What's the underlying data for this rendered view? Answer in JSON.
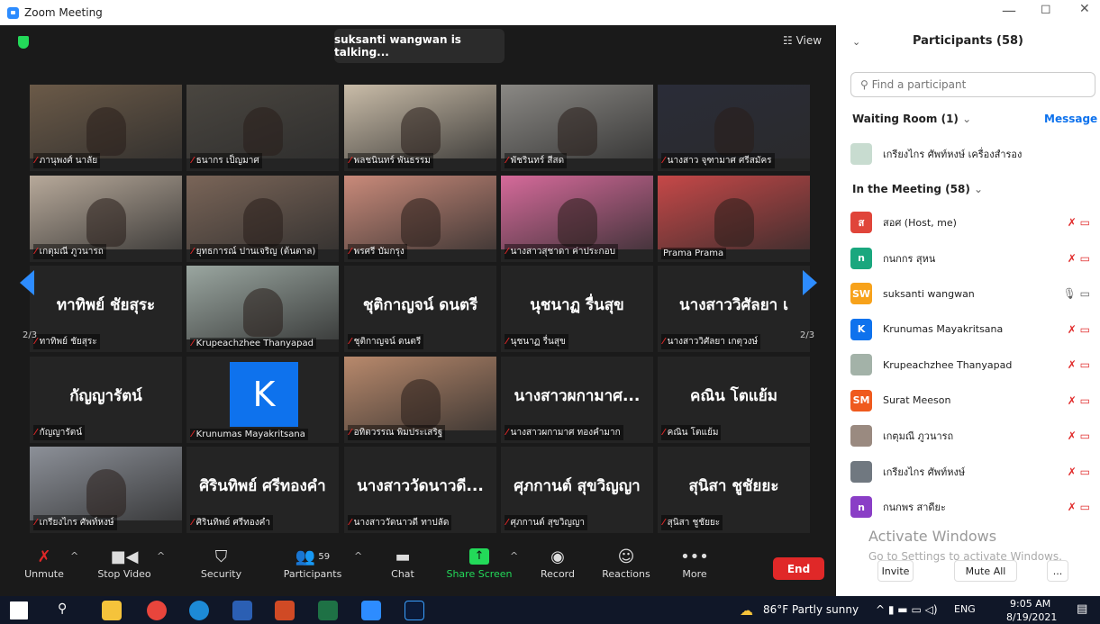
{
  "window": {
    "title": "Zoom Meeting",
    "min": "—",
    "max": "◻",
    "close": "✕"
  },
  "video": {
    "talking": "suksanti wangwan is talking...",
    "view": "☷ View",
    "page_left": "2/3",
    "page_right": "2/3"
  },
  "tiles": [
    {
      "label": "ภานุพงศ์ นาลัย",
      "kind": "photo",
      "color": "#6b5a48"
    },
    {
      "label": "ธนากร เป็ญมาศ",
      "kind": "photo",
      "color": "#4a4640"
    },
    {
      "label": "พลชนินทร์ พันธรรม",
      "kind": "photo",
      "color": "#c9bca8"
    },
    {
      "label": "พัชรินทร์ สีสด",
      "kind": "photo",
      "color": "#8a8884"
    },
    {
      "label": "นางสาว จุฑามาศ ศรีสมัคร",
      "kind": "photo",
      "color": "#2a2c38"
    },
    {
      "label": "เกตุมณี ภูวนารถ",
      "kind": "photo",
      "color": "#b7a99a"
    },
    {
      "label": "ยุทธการณ์ ปานเจริญ (ต้นตาล)",
      "kind": "photo",
      "color": "#7a6558"
    },
    {
      "label": "พรศรี บัมกรุง",
      "kind": "photo",
      "color": "#c98a7a"
    },
    {
      "label": "นางสาวสุชาดา ค่าประกอบ",
      "kind": "photo",
      "color": "#d56a9a"
    },
    {
      "label": "Prama Prama",
      "kind": "photo",
      "color": "#c64848"
    },
    {
      "label": "ทาทิพย์ ชัยสุระ",
      "kind": "text",
      "name": "ทาทิพย์ ชัยสุระ"
    },
    {
      "label": "Krupeachzhee Thanyapad",
      "kind": "photo",
      "color": "#9aa6a0"
    },
    {
      "label": "ชุติกาญจน์ ดนตรี",
      "kind": "text",
      "name": "ชุติกาญจน์ ดนตรี"
    },
    {
      "label": "นุชนาฏ รื่นสุข",
      "kind": "text",
      "name": "นุชนาฏ รื่นสุข"
    },
    {
      "label": "นางสาววิศัลยา เกตุวงษ์",
      "kind": "text",
      "name": "นางสาววิศัลยา เ"
    },
    {
      "label": "กัญญารัตน์",
      "kind": "text",
      "name": "กัญญารัตน์"
    },
    {
      "label": "Krunumas Mayakritsana",
      "kind": "avatar",
      "letter": "K"
    },
    {
      "label": "อทิตวรรณ พิมประเสริฐ",
      "kind": "photo",
      "color": "#b8896c"
    },
    {
      "label": "นางสาวผกามาศ ทองคำมาก",
      "kind": "text",
      "name": "นางสาวผกามาศ..."
    },
    {
      "label": "คณิน โตแย้ม",
      "kind": "text",
      "name": "คณิน โตแย้ม"
    },
    {
      "label": "เกรียงไกร ศัพท์หงษ์",
      "kind": "photo",
      "color": "#8c9098"
    },
    {
      "label": "ศิรินทิพย์ ศรีทองคำ",
      "kind": "text",
      "name": "ศิรินทิพย์ ศรีทองคำ"
    },
    {
      "label": "นางสาววัดนาวดี ทาปลัด",
      "kind": "text",
      "name": "นางสาววัดนาวดี..."
    },
    {
      "label": "ศุภกานต์ สุขวิญญา",
      "kind": "text",
      "name": "ศุภกานต์ สุขวิญญา"
    },
    {
      "label": "สุนิสา ชูชัยยะ",
      "kind": "text",
      "name": "สุนิสา ชูชัยยะ"
    }
  ],
  "toolbar": {
    "unmute": "Unmute",
    "stop_video": "Stop Video",
    "security": "Security",
    "participants": "Participants",
    "participants_count": "59",
    "chat": "Chat",
    "share": "Share Screen",
    "record": "Record",
    "reactions": "Reactions",
    "more": "More",
    "end": "End"
  },
  "panel": {
    "title": "Participants (58)",
    "search_placeholder": "Find a participant",
    "waiting": "Waiting Room (1)",
    "message": "Message",
    "in_meeting": "In the Meeting (58)",
    "activate1": "Activate Windows",
    "activate2": "Go to Settings to activate Windows.",
    "invite": "Invite",
    "mute_all": "Mute All",
    "more": "..."
  },
  "waiting_person": {
    "name": "เกรียงไกร ศัพท์หงษ์ เครื่องสำรอง",
    "color": "#c8dcd0"
  },
  "participants": [
    {
      "name": "สอศ (Host, me)",
      "initial": "ส",
      "color": "#e0453a"
    },
    {
      "name": "กนกกร สุหน",
      "initial": "n",
      "color": "#1aa77e"
    },
    {
      "name": "suksanti wangwan",
      "initial": "SW",
      "color": "#f7a21b"
    },
    {
      "name": "Krunumas Mayakritsana",
      "initial": "K",
      "color": "#0e72ed"
    },
    {
      "name": "Krupeachzhee Thanyapad",
      "initial": "",
      "color": "#a3b2a8"
    },
    {
      "name": "Surat Meeson",
      "initial": "SM",
      "color": "#ef5a1e"
    },
    {
      "name": "เกตุมณี ภูวนารถ",
      "initial": "",
      "color": "#9a8a80"
    },
    {
      "name": "เกรียงไกร ศัพท์หงษ์",
      "initial": "",
      "color": "#707880"
    },
    {
      "name": "กนกพร สาดียะ",
      "initial": "n",
      "color": "#8a3ec6"
    }
  ],
  "taskbar": {
    "weather": "86°F Partly sunny",
    "lang": "ENG",
    "time": "9:05 AM",
    "date": "8/19/2021"
  }
}
